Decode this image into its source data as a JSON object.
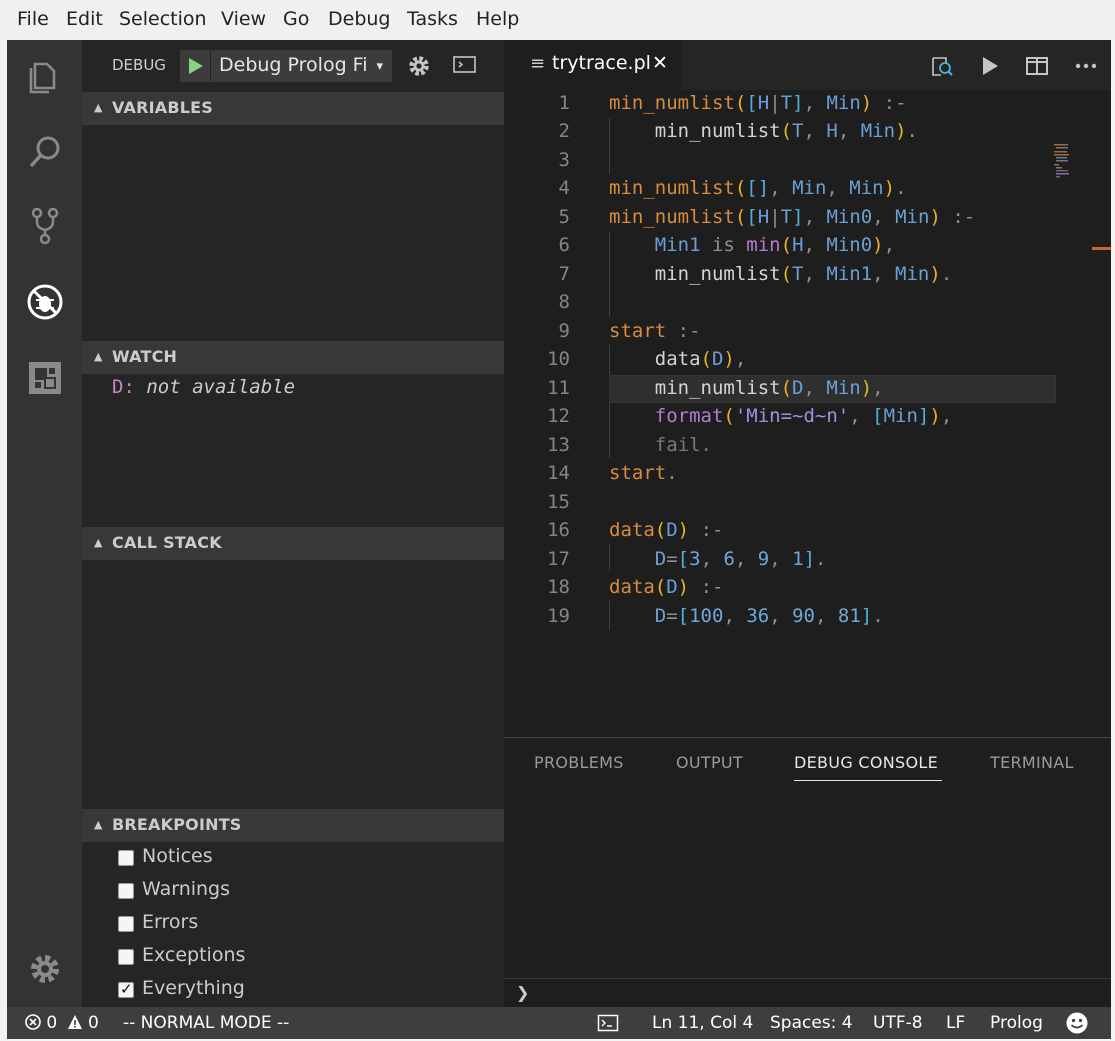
{
  "menu": [
    "File",
    "Edit",
    "Selection",
    "View",
    "Go",
    "Debug",
    "Tasks",
    "Help"
  ],
  "activity_icons": [
    "explorer-icon",
    "search-icon",
    "source-control-icon",
    "debug-icon",
    "extensions-icon",
    "settings-gear-icon"
  ],
  "debug": {
    "label": "DEBUG",
    "configuration": "Debug Prolog Fi",
    "caret": "▾"
  },
  "sections": {
    "variables": "VARIABLES",
    "watch": "WATCH",
    "call_stack": "CALL STACK",
    "breakpoints": "BREAKPOINTS"
  },
  "watch": [
    {
      "name": "D:",
      "value": "not available"
    }
  ],
  "breakpoints": [
    {
      "label": "Notices",
      "checked": false
    },
    {
      "label": "Warnings",
      "checked": false
    },
    {
      "label": "Errors",
      "checked": false
    },
    {
      "label": "Exceptions",
      "checked": false
    },
    {
      "label": "Everything",
      "checked": true
    }
  ],
  "editor": {
    "tab_label": "trytrace.pl",
    "tab_icon": "≡",
    "tab_close": "✕",
    "current_line": 11,
    "line_numbers": [
      "1",
      "2",
      "3",
      "4",
      "5",
      "6",
      "7",
      "8",
      "9",
      "10",
      "11",
      "12",
      "13",
      "14",
      "15",
      "16",
      "17",
      "18",
      "19"
    ]
  },
  "panel": {
    "tabs": [
      "PROBLEMS",
      "OUTPUT",
      "DEBUG CONSOLE",
      "TERMINAL"
    ],
    "active_tab": "DEBUG CONSOLE",
    "prompt": "❯"
  },
  "status": {
    "errors": "0",
    "warnings": "0",
    "mode": "-- NORMAL MODE  --",
    "position": "Ln 11, Col 4",
    "spaces": "Spaces: 4",
    "encoding": "UTF-8",
    "eol": "LF",
    "language": "Prolog"
  },
  "colors": {
    "activity_bar": "#333333",
    "sidebar": "#252526",
    "editor": "#1e1e1e",
    "statusbar": "#3e3e3e",
    "predicate": "#d98c3f",
    "variable": "#6a9fd4",
    "start_button": "#89d185"
  }
}
